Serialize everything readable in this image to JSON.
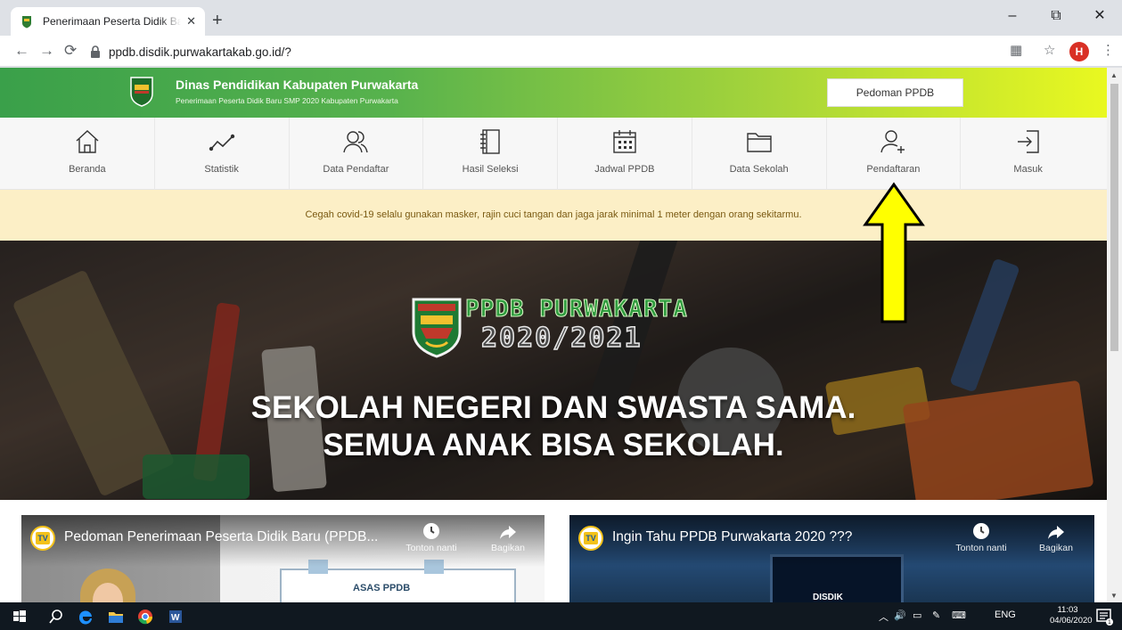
{
  "browser": {
    "tab_title": "Penerimaan Peserta Didik Baru SMP",
    "url": "ppdb.disdik.purwakartakab.go.id/?",
    "profile_initial": "H"
  },
  "site": {
    "title": "Dinas Pendidikan Kabupaten Purwakarta",
    "subtitle": "Penerimaan Peserta Didik Baru SMP 2020 Kabupaten Purwakarta",
    "pedoman_label": "Pedoman PPDB"
  },
  "nav": {
    "items": [
      {
        "label": "Beranda",
        "icon": "home-icon"
      },
      {
        "label": "Statistik",
        "icon": "trend-line-icon"
      },
      {
        "label": "Data Pendaftar",
        "icon": "users-icon"
      },
      {
        "label": "Hasil Seleksi",
        "icon": "notebook-icon"
      },
      {
        "label": "Jadwal PPDB",
        "icon": "calendar-icon"
      },
      {
        "label": "Data Sekolah",
        "icon": "folder-icon"
      },
      {
        "label": "Pendaftaran",
        "icon": "user-plus-icon"
      },
      {
        "label": "Masuk",
        "icon": "login-icon"
      }
    ]
  },
  "notice": "Cegah covid-19 selalu gunakan masker, rajin cuci tangan dan jaga jarak minimal 1 meter dengan orang sekitarmu.",
  "hero": {
    "brand_line1": "PPDB PURWAKARTA",
    "brand_line2": "2020/2021",
    "tagline1": "SEKOLAH NEGERI DAN SWASTA SAMA.",
    "tagline2": "SEMUA ANAK BISA SEKOLAH."
  },
  "videos": [
    {
      "title": "Pedoman Penerimaan Peserta Didik Baru (PPDB...",
      "watch_later": "Tonton nanti",
      "share": "Bagikan",
      "channel": "TV",
      "slide_text": "ASAS PPDB"
    },
    {
      "title": "Ingin Tahu PPDB Purwakarta 2020 ???",
      "watch_later": "Tonton nanti",
      "share": "Bagikan",
      "channel": "TV",
      "screen_text": "DISDIK"
    }
  ],
  "taskbar": {
    "lang": "ENG",
    "time": "11:03",
    "date": "04/06/2020",
    "notification_count": "1"
  },
  "colors": {
    "header_start": "#3aa04a",
    "header_end": "#e9f820",
    "notice_bg": "#fcefc6",
    "arrow": "#ffff00"
  }
}
